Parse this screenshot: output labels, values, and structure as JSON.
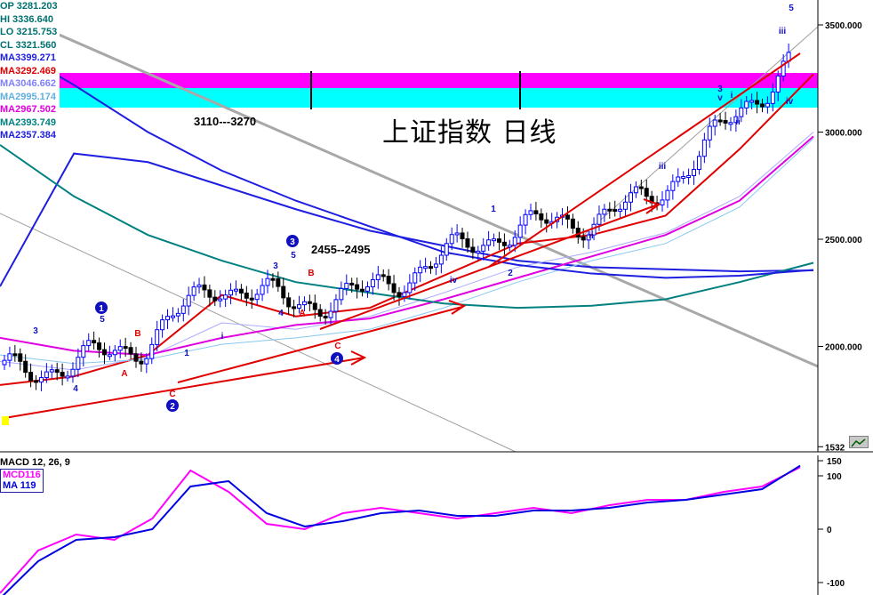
{
  "title": "上证指数  日线",
  "band_label": "3110---3270",
  "zone_label": "2455--2495",
  "readout": [
    {
      "label": "OP 3281.203",
      "color": "#007070"
    },
    {
      "label": "HI  3336.640",
      "color": "#007070"
    },
    {
      "label": "LO  3215.753",
      "color": "#007070"
    },
    {
      "label": "CL  3321.560",
      "color": "#007070"
    },
    {
      "label": "MA3399.271",
      "color": "#1e1ee0"
    },
    {
      "label": "MA3292.469",
      "color": "#e00000"
    },
    {
      "label": "MA3046.662",
      "color": "#aaaaff"
    },
    {
      "label": "MA2995.174",
      "color": "#88c8f0"
    },
    {
      "label": "MA2967.502",
      "color": "#e000e0"
    },
    {
      "label": "MA2393.749",
      "color": "#008080"
    },
    {
      "label": "MA2357.384",
      "color": "#1e1ee0"
    }
  ],
  "macd_legend": {
    "name": "MACD 12, 26, 9",
    "macd": "MCD116",
    "signal": "MA  119",
    "macd_color": "#ff00ff",
    "signal_color": "#0000e0"
  },
  "colors": {
    "band_magenta": "#ff00ff",
    "band_cyan": "#00ffff",
    "up_bar": "#0000ff",
    "down_bar": "#000000",
    "wave_blue": "#1010c0",
    "wave_red": "#e00000"
  },
  "chart_data": [
    {
      "type": "candlestick",
      "title": "上证指数  日线",
      "y_axis_labels": [
        "3500.000",
        "3000.000",
        "2500.000",
        "2000.000",
        "1532"
      ],
      "ylim": [
        1532,
        3620
      ],
      "resistance_band": [
        3110,
        3270
      ],
      "series": [
        {
          "name": "MA3399.271",
          "values": [
            2280,
            2900,
            2860,
            2750,
            2640,
            2540,
            2470,
            2400,
            2370,
            2360,
            2350,
            2355
          ]
        },
        {
          "name": "MA3292.469",
          "values": [
            1820,
            1860,
            1960,
            2240,
            2140,
            2180,
            2330,
            2480,
            2520,
            2610,
            2920,
            3270
          ]
        },
        {
          "name": "MA3046.662",
          "values": [
            1930,
            1890,
            1950,
            2110,
            2080,
            2140,
            2250,
            2370,
            2440,
            2530,
            2700,
            3000
          ]
        },
        {
          "name": "MA2995.174",
          "values": [
            1960,
            1920,
            1940,
            2010,
            2040,
            2080,
            2180,
            2300,
            2400,
            2480,
            2650,
            2970
          ]
        },
        {
          "name": "MA2967.502",
          "values": [
            2040,
            1980,
            1960,
            2040,
            2100,
            2130,
            2220,
            2320,
            2420,
            2520,
            2680,
            2980
          ]
        },
        {
          "name": "MA2393.749",
          "values": [
            2940,
            2700,
            2520,
            2400,
            2300,
            2250,
            2200,
            2180,
            2190,
            2220,
            2300,
            2390
          ]
        },
        {
          "name": "MA2357.384",
          "values": [
            3420,
            3220,
            3000,
            2820,
            2680,
            2560,
            2440,
            2380,
            2340,
            2320,
            2330,
            2357
          ]
        }
      ],
      "wave_labels": [
        "1",
        "2",
        "3",
        "4",
        "5",
        "A",
        "B",
        "C",
        "i",
        "ii",
        "iii",
        "iv",
        "v"
      ],
      "circled_waves": [
        "1",
        "2",
        "3",
        "4"
      ]
    },
    {
      "type": "line",
      "title": "MACD 12, 26, 9",
      "y_axis_labels": [
        "100",
        "0",
        "-100",
        "150"
      ],
      "ylim": [
        -110,
        130
      ],
      "series": [
        {
          "name": "MCD116",
          "values": [
            -120,
            -40,
            -10,
            -20,
            20,
            110,
            70,
            10,
            0,
            30,
            40,
            30,
            20,
            30,
            40,
            30,
            45,
            55,
            55,
            70,
            80,
            116
          ]
        },
        {
          "name": "MA  119",
          "values": [
            -130,
            -60,
            -20,
            -15,
            0,
            80,
            90,
            30,
            5,
            15,
            30,
            35,
            25,
            25,
            35,
            35,
            40,
            50,
            55,
            65,
            75,
            119
          ]
        }
      ]
    }
  ]
}
